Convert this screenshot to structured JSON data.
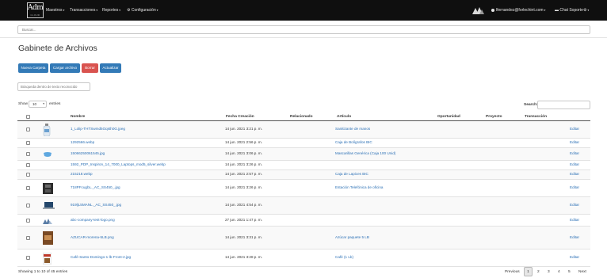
{
  "navbar": {
    "logo_text": "Adm",
    "logo_sub": "CLOUD",
    "menu": [
      "Maestros",
      "Transacciones",
      "Reportes",
      "Configuración"
    ],
    "user_email": "lfernandez@forlechint.com",
    "chat_label": "Chat Soporte"
  },
  "search": {
    "placeholder": "Buscar..."
  },
  "page": {
    "title": "Gabinete de Archivos",
    "buttons": {
      "new_folder": "Nueva Carpeta",
      "upload": "Cargar archivo",
      "delete": "Borrar",
      "refresh": "Actualizar"
    },
    "filter_placeholder": "Búsqueda dentro de texto reconocido"
  },
  "table_controls": {
    "show_label": "Show",
    "page_length": "10",
    "entries_label": "entries",
    "search_label": "Search:"
  },
  "table": {
    "columns": [
      "Nombre",
      "Fecha Creación",
      "Relacionado",
      "Artículo",
      "Oportunidad",
      "Proyecto",
      "Transacción"
    ],
    "edit_label": "Editar",
    "rows": [
      {
        "name": "1_Lolip-THTSwmd5Oqsth0G.jpeg",
        "date": "14 jun. 2021 3:21 p. m.",
        "article": "Sanitizante de manos",
        "thumb": "bottle"
      },
      {
        "name": "1292566.webp",
        "date": "14 jun. 2021 2:56 p. m.",
        "article": "Caja de Bolígrafos BIC",
        "thumb": "none"
      },
      {
        "name": "15066250061545.jpg",
        "date": "14 jun. 2021 3:06 p. m.",
        "article": "Mascarillas Genérica (Caja 100 Unid)",
        "thumb": "mask"
      },
      {
        "name": "1592_PDP_Inspiron_14_7000_Laptops_mod5_silver.webp",
        "date": "14 jun. 2021 3:26 p. m.",
        "article": "",
        "thumb": "none"
      },
      {
        "name": "215218.webp",
        "date": "14 jun. 2021 2:57 p. m.",
        "article": "Caja de Lapices BIC",
        "thumb": "none"
      },
      {
        "name": "718PFcugbL._AC_SS450_.jpg",
        "date": "14 jun. 2021 3:26 p. m.",
        "article": "Estación Telefónica de oficina",
        "thumb": "phone"
      },
      {
        "name": "919ljL5MANL._AC_SS450_.jpg",
        "date": "14 jun. 2021 4:54 p. m.",
        "article": "",
        "thumb": "laptop"
      },
      {
        "name": "abc-company-test-logo.png",
        "date": "27 jun. 2021 1:47 p. m.",
        "article": "",
        "thumb": "logo"
      },
      {
        "name": "AZUCAR-morena-5LB.png",
        "date": "14 jun. 2021 3:31 p. m.",
        "article": "Azúcar paquete 5 LB",
        "thumb": "sugar"
      },
      {
        "name": "Café-Santo-Domingo-1-lb-Front-2.jpg",
        "date": "14 jun. 2021 3:28 p. m.",
        "article": "Café (1 Lb)",
        "thumb": "coffee"
      }
    ]
  },
  "footer": {
    "info": "Showing 1 to 10 of 45 entries",
    "previous": "Previous",
    "pages": [
      "1",
      "2",
      "3",
      "4",
      "5"
    ],
    "next": "Next"
  },
  "colors": {
    "navbar": "#0f0f0f",
    "primary": "#337ab7",
    "danger": "#d9534f",
    "link": "#2a6fb5"
  },
  "icons": [
    "user-icon",
    "chat-icon",
    "gear-icon",
    "cog-icon",
    "brand-mark-icon"
  ]
}
